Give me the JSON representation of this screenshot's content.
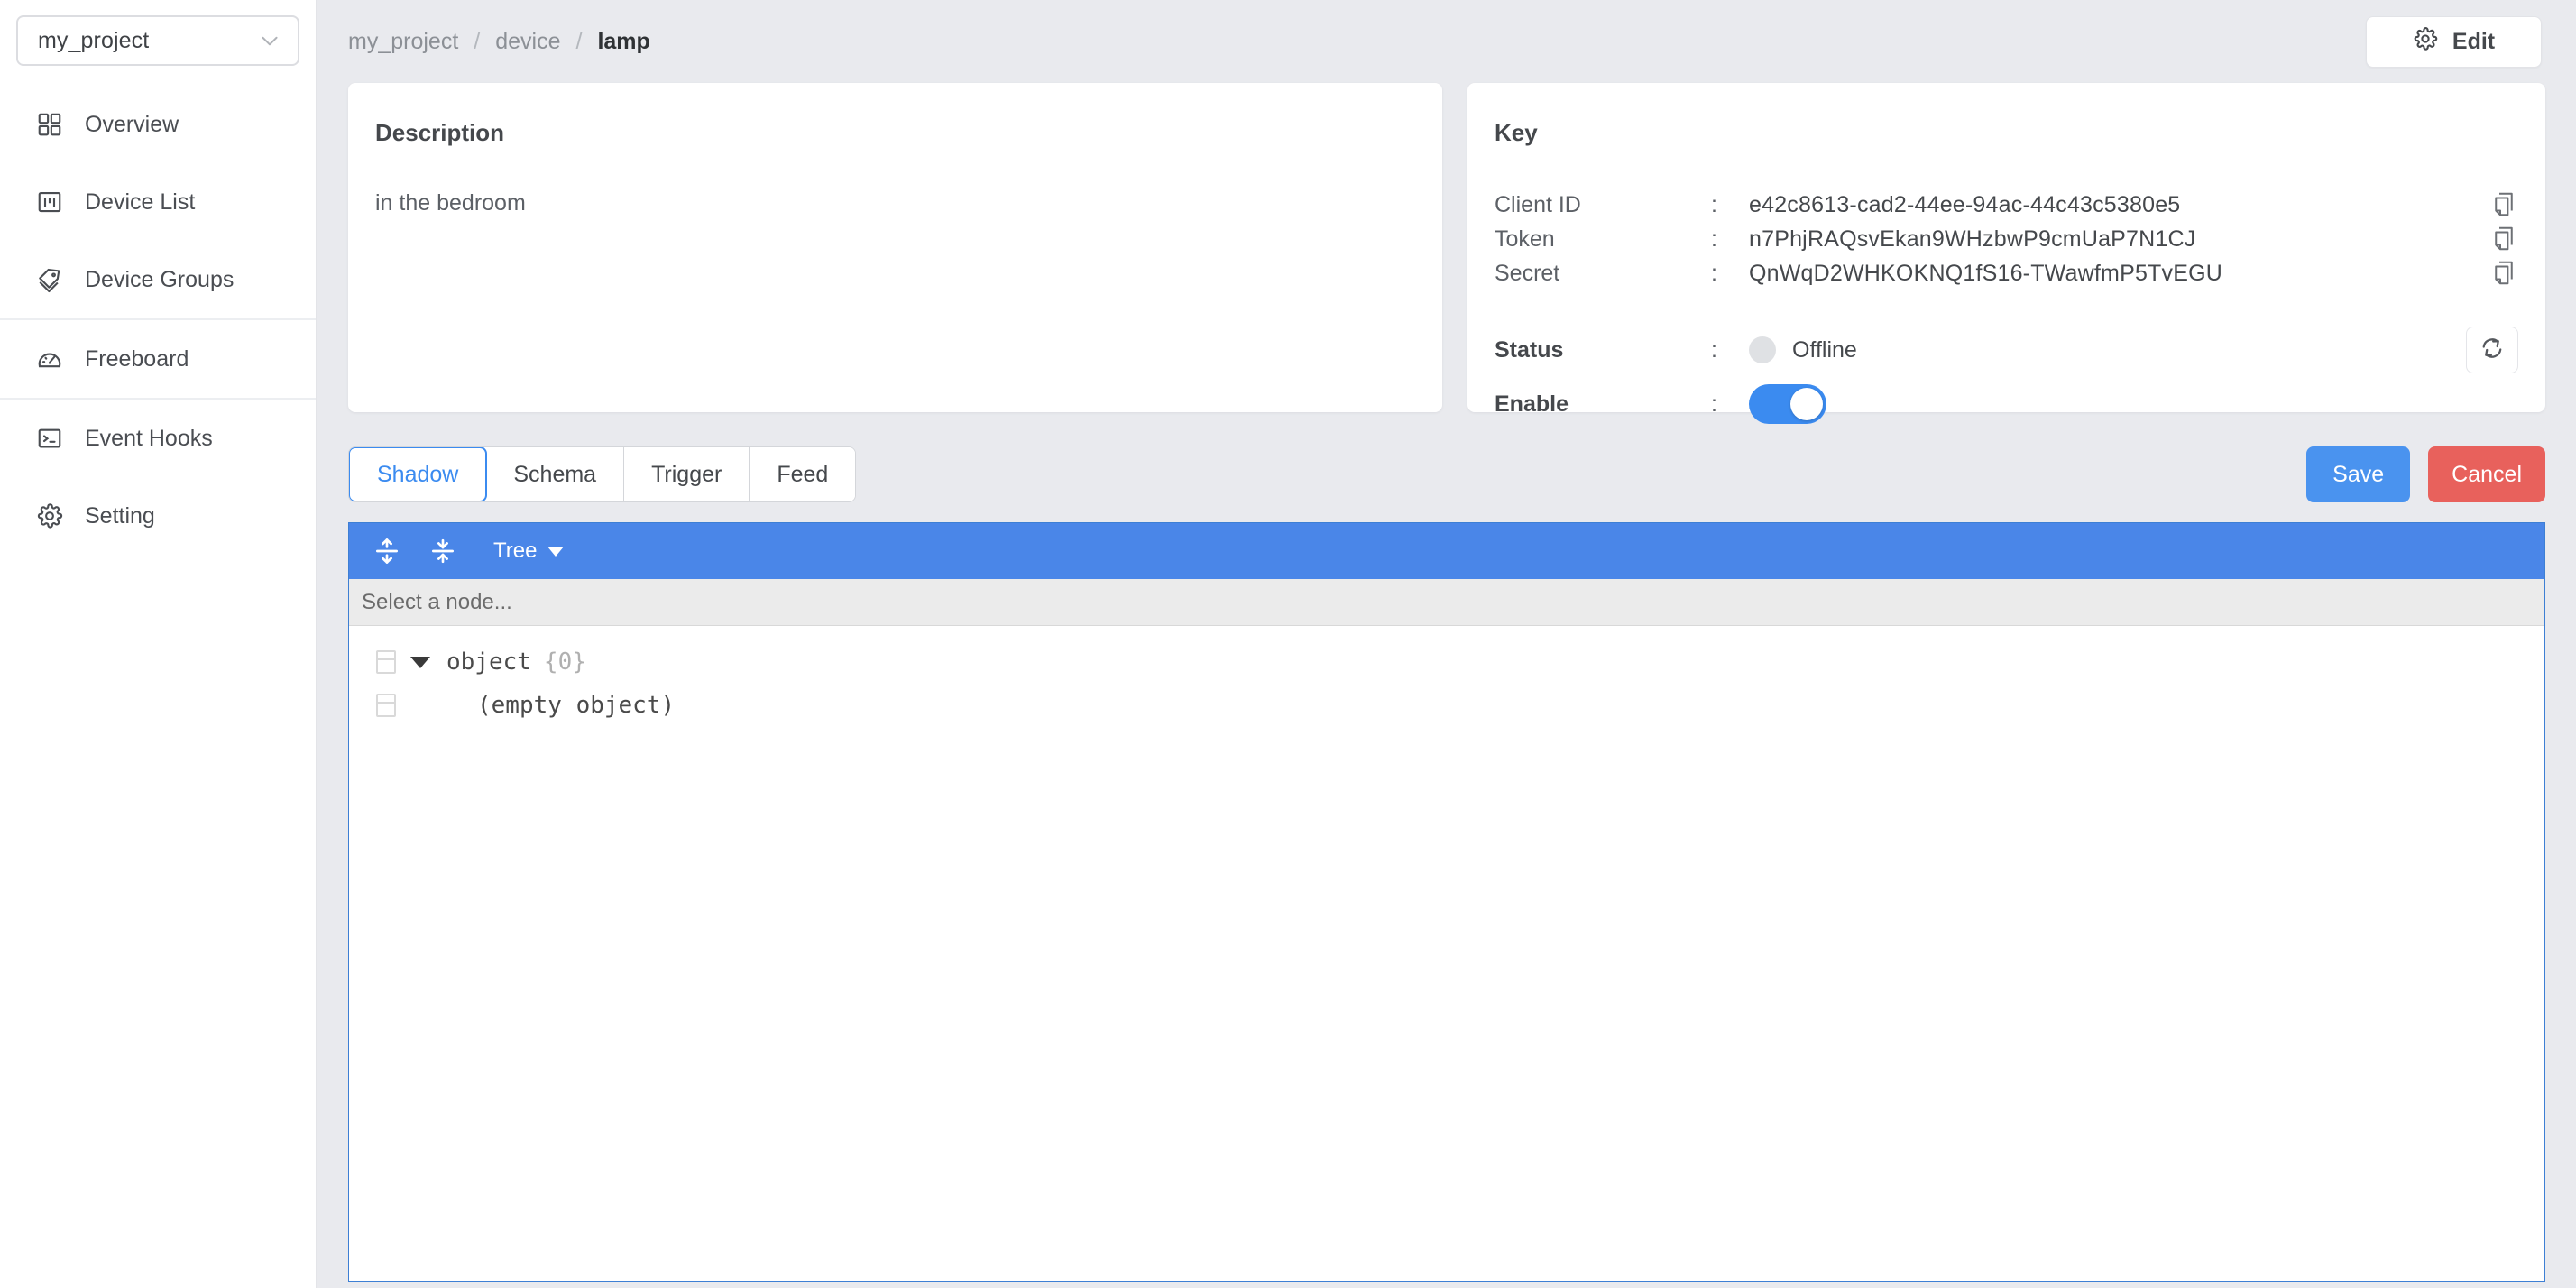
{
  "sidebar": {
    "project_selector": {
      "value": "my_project",
      "icon": "chevron-down-icon"
    },
    "items": [
      {
        "label": "Overview",
        "icon": "grid-icon"
      },
      {
        "label": "Device List",
        "icon": "kanban-icon"
      },
      {
        "label": "Device Groups",
        "icon": "tag-icon"
      },
      {
        "label": "Freeboard",
        "icon": "gauge-icon"
      },
      {
        "label": "Event Hooks",
        "icon": "terminal-icon"
      },
      {
        "label": "Setting",
        "icon": "gear-icon"
      }
    ]
  },
  "topbar": {
    "breadcrumb": [
      "my_project",
      "device",
      "lamp"
    ],
    "separator": "/",
    "edit_label": "Edit",
    "edit_icon": "gear-icon"
  },
  "description_card": {
    "title": "Description",
    "body": "in the bedroom"
  },
  "key_card": {
    "title": "Key",
    "colon": ":",
    "rows": [
      {
        "label": "Client ID",
        "value": "e42c8613-cad2-44ee-94ac-44c43c5380e5",
        "action_icon": "copy-icon"
      },
      {
        "label": "Token",
        "value": "n7PhjRAQsvEkan9WHzbwP9cmUaP7N1CJ",
        "action_icon": "copy-icon"
      },
      {
        "label": "Secret",
        "value": "QnWqD2WHKOKNQ1fS16-TWawfmP5TvEGU",
        "action_icon": "copy-icon"
      }
    ],
    "status": {
      "label": "Status",
      "value": "Offline",
      "dot_color": "#dfe1e4",
      "refresh_icon": "refresh-icon"
    },
    "enable": {
      "label": "Enable",
      "on": true,
      "on_color": "#3b8bf0"
    }
  },
  "tabs": [
    {
      "label": "Shadow",
      "active": true
    },
    {
      "label": "Schema",
      "active": false
    },
    {
      "label": "Trigger",
      "active": false
    },
    {
      "label": "Feed",
      "active": false
    }
  ],
  "actions": {
    "save_label": "Save",
    "cancel_label": "Cancel",
    "save_color": "#4a93ef",
    "cancel_color": "#e8615c"
  },
  "editor": {
    "toolbar": {
      "expand_icon": "expand-all-icon",
      "collapse_icon": "collapse-all-icon",
      "mode_label": "Tree",
      "mode_caret": "caret-down-icon",
      "background": "#4a86e8"
    },
    "node_bar_text": "Select a node...",
    "tree": {
      "root_label": "object",
      "root_count": "{0}",
      "empty_label": "(empty object)"
    }
  }
}
